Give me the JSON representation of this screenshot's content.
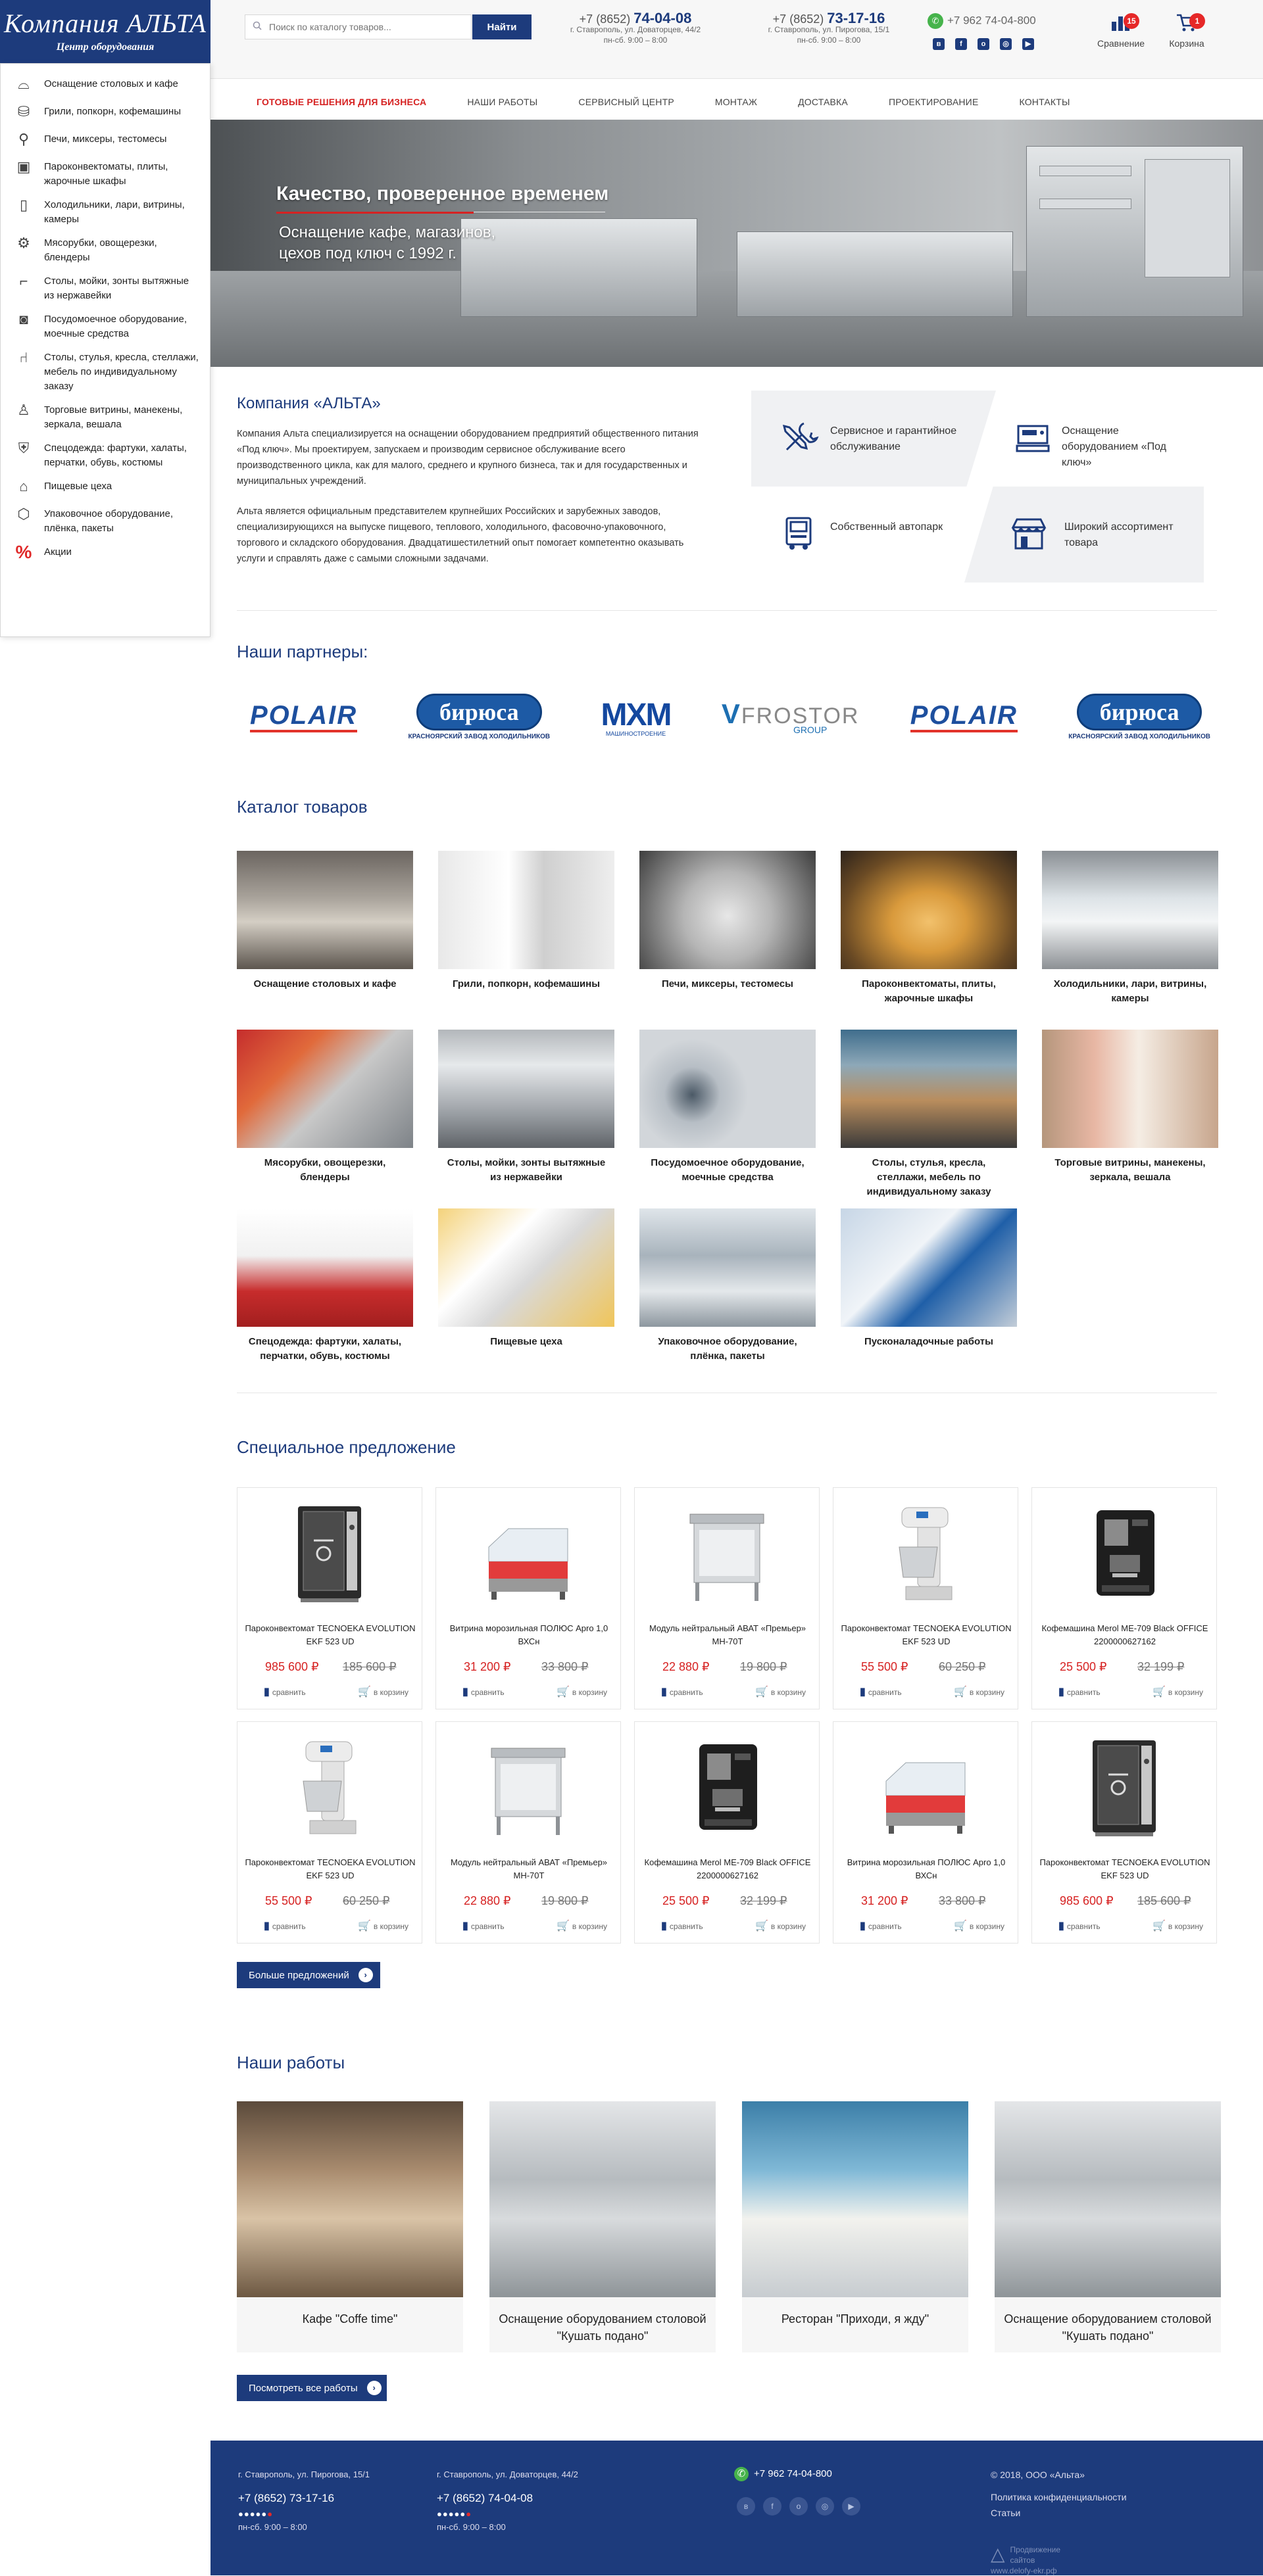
{
  "logo": {
    "title": "Компания  АЛЬТА",
    "subtitle": "Центр оборудования"
  },
  "search": {
    "placeholder": "Поиск по каталогу товаров...",
    "button": "Найти"
  },
  "phones": [
    {
      "code": "+7 (8652)",
      "number": "74-04-08",
      "addr": "г. Ставрополь,  ул. Доваторцев, 44/2",
      "hours": "пн-сб. 9:00 – 8:00"
    },
    {
      "code": "+7 (8652)",
      "number": "73-17-16",
      "addr": "г. Ставрополь, ул. Пирогова, 15/1",
      "hours": "пн-сб. 9:00 – 8:00"
    }
  ],
  "whatsapp": "+7 962 74-04-800",
  "compare": {
    "label": "Сравнение",
    "count": "15"
  },
  "cart": {
    "label": "Корзина",
    "count": "1"
  },
  "nav": [
    "Готовые решения для бизнеса",
    "Наши работы",
    "Сервисный центр",
    "Монтаж",
    "Доставка",
    "Проектирование",
    "Контакты"
  ],
  "sidebar": [
    {
      "label": "Оснащение столовых и кафе",
      "icon": "tray-icon"
    },
    {
      "label": "Грили, попкорн, кофемашины",
      "icon": "popcorn-icon"
    },
    {
      "label": "Печи, миксеры, тестомесы",
      "icon": "mixer-icon"
    },
    {
      "label": "Пароконвектоматы, плиты, жарочные шкафы",
      "icon": "oven-icon"
    },
    {
      "label": "Холодильники, лари, витрины, камеры",
      "icon": "fridge-icon"
    },
    {
      "label": "Мясорубки, овощерезки, блендеры",
      "icon": "grinder-icon"
    },
    {
      "label": "Столы, мойки, зонты вытяжные из нержавейки",
      "icon": "sink-icon"
    },
    {
      "label": "Посудомоечное оборудование, моечные средства",
      "icon": "dishwasher-icon"
    },
    {
      "label": "Столы, стулья, кресла, стеллажи, мебель по индивидуальному заказу",
      "icon": "chair-icon"
    },
    {
      "label": "Торговые витрины, манекены, зеркала, вешала",
      "icon": "mannequin-icon"
    },
    {
      "label": "Спецодежда: фартуки, халаты, перчатки, обувь, костюмы",
      "icon": "apron-icon"
    },
    {
      "label": "Пищевые цеха",
      "icon": "factory-icon"
    },
    {
      "label": "Упаковочное оборудование, плёнка, пакеты",
      "icon": "package-icon"
    },
    {
      "label": "Акции",
      "icon": "percent-icon"
    }
  ],
  "hero": {
    "title": "Качество, проверенное временем",
    "text1": "Оснащение кафе,  магазинов,",
    "text2": "цехов под ключ с 1992 г."
  },
  "about": {
    "title": "Компания «АЛЬТА»",
    "p1": "Компания Альта специализируется на оснащении оборудованием предприятий общественного питания «Под ключ». Мы проектируем, запускаем и производим сервисное обслуживание всего производственного цикла, как для малого, среднего и крупного бизнеса, так и для государственных и муниципальных учреждений.",
    "p2": "Альта является официальным представителем крупнейших Российских и зарубежных заводов, специализирующихся на выпуске пищевого, теплового, холодильного, фасовочно-упаковочного, торгового и складского оборудования.  Двадцатишестилетний опыт помогает компетентно оказывать услуги и справлять даже с самыми сложными задачами."
  },
  "features": [
    {
      "label": "Сервисное и гарантийное обслуживание",
      "icon": "tools-icon"
    },
    {
      "label": "Оснащение оборудованием «Под ключ»",
      "icon": "scale-icon"
    },
    {
      "label": "Собственный автопарк",
      "icon": "truck-icon"
    },
    {
      "label": "Широкий ассортимент товара",
      "icon": "shop-icon"
    }
  ],
  "partners_title": "Наши партнеры:",
  "partners": [
    {
      "name": "POLAIR"
    },
    {
      "name": "бирюса",
      "sub": "КРАСНОЯРСКИЙ ЗАВОД ХОЛОДИЛЬНИКОВ"
    },
    {
      "name": "MXM",
      "sub": "МАШИНОСТРОЕНИЕ"
    },
    {
      "name": "FROSTOR",
      "sub": "GROUP"
    },
    {
      "name": "POLAIR"
    },
    {
      "name": "бирюса",
      "sub": "КРАСНОЯРСКИЙ ЗАВОД ХОЛОДИЛЬНИКОВ"
    }
  ],
  "catalog_title": "Каталог  товаров",
  "catalog": [
    "Оснащение столовых и кафе",
    "Грили, попкорн, кофемашины",
    "Печи, миксеры, тестомесы",
    "Пароконвектоматы, плиты, жарочные шкафы",
    "Холодильники, лари, витрины, камеры",
    "Мясорубки,  овощерезки, блендеры",
    "Столы, мойки,  зонты вытяжные из нержавейки",
    "Посудомоечное оборудование, моечные средства",
    "Столы, стулья, кресла, стеллажи, мебель по индивидуальному заказу",
    "Торговые витрины,  манекены, зеркала,  вешала",
    "Спецодежда: фартуки, халаты, перчатки, обувь, костюмы",
    "Пищевые цеха",
    "Упаковочное оборудование, плёнка, пакеты",
    "Пусконаладочные работы"
  ],
  "special_title": "Специальное предложение",
  "products": [
    {
      "name": "Пароконвектомат TECNOEKA EVOLUTION EKF 523 UD",
      "price": "985 600 ₽",
      "old": "185 600 ₽",
      "type": "oven"
    },
    {
      "name": "Витрина морозильная ПОЛЮС Apro 1,0 ВХСн",
      "price": "31 200 ₽",
      "old": "33 800 ₽",
      "type": "showcase"
    },
    {
      "name": "Модуль нейтральный АВАТ «Премьер» МН-70Т",
      "price": "22 880 ₽",
      "old": "19 800 ₽",
      "type": "module"
    },
    {
      "name": "Пароконвектомат TECNOEKA EVOLUTION EKF 523 UD",
      "price": "55 500 ₽",
      "old": "60 250 ₽",
      "type": "mixer"
    },
    {
      "name": "Кофемашина Merol ME-709 Black OFFICE 2200000627162",
      "price": "25 500 ₽",
      "old": "32 199 ₽",
      "type": "coffee"
    },
    {
      "name": "Пароконвектомат TECNOEKA EVOLUTION EKF 523 UD",
      "price": "55 500 ₽",
      "old": "60 250 ₽",
      "type": "mixer"
    },
    {
      "name": "Модуль нейтральный АВАТ «Премьер» МН-70Т",
      "price": "22 880 ₽",
      "old": "19 800 ₽",
      "type": "module"
    },
    {
      "name": "Кофемашина Merol ME-709 Black OFFICE 2200000627162",
      "price": "25 500 ₽",
      "old": "32 199 ₽",
      "type": "coffee"
    },
    {
      "name": "Витрина морозильная ПОЛЮС Apro 1,0 ВХСн",
      "price": "31 200 ₽",
      "old": "33 800 ₽",
      "type": "showcase"
    },
    {
      "name": "Пароконвектомат TECNOEKA EVOLUTION EKF 523 UD",
      "price": "985 600 ₽",
      "old": "185 600 ₽",
      "type": "oven"
    }
  ],
  "compare_label": "сравнить",
  "cart_label": "в корзину",
  "more_offers": "Больше предложений",
  "works_title": "Наши работы",
  "works": [
    "Кафе \"Coffe time\"",
    "Оснащение оборудованием столовой \"Кушать подано\"",
    "Ресторан \"Приходи, я жду\"",
    "Оснащение оборудованием столовой \"Кушать подано\""
  ],
  "all_works": "Посмотреть все работы",
  "footer": {
    "addr1": "г. Ставрополь,  ул. Пирогова, 15/1",
    "phone1": "+7 (8652)  73-17-16",
    "hours1": "пн-сб. 9:00 – 8:00",
    "addr2": "г. Ставрополь,  ул. Доваторцев, 44/2",
    "phone2": "+7 (8652)  74-04-08",
    "hours2": "пн-сб. 9:00 – 8:00",
    "whatsapp": "+7 962 74-04-800",
    "copyright": "© 2018, ООО «Альта»",
    "privacy": "Политика конфиденциальности",
    "articles": "Статьи",
    "dev1": "Продвижение сайтов",
    "dev2": "www.delofy-ekr.pф"
  }
}
